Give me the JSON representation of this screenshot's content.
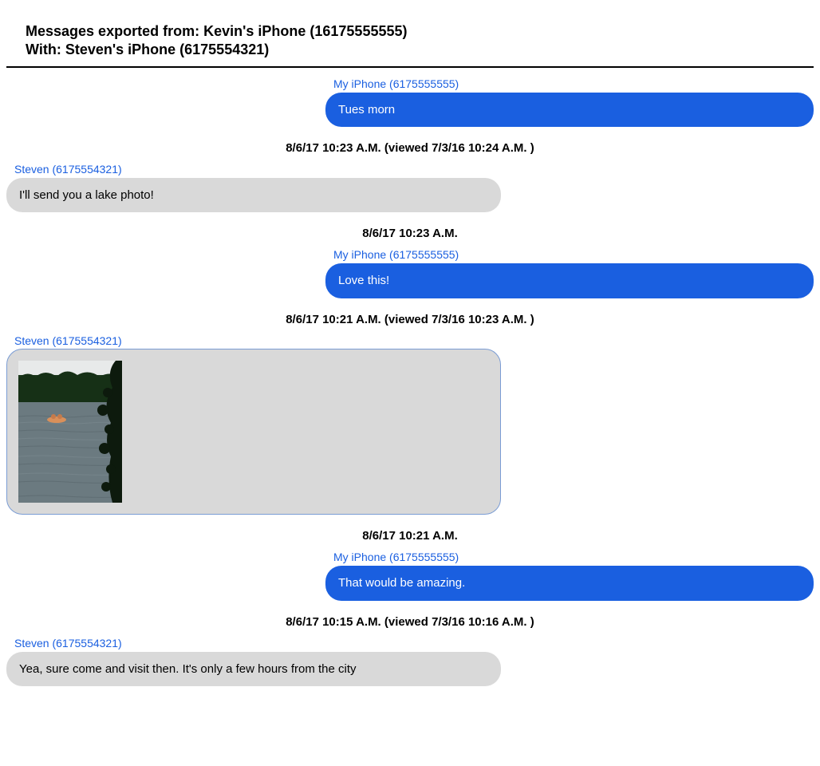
{
  "header": {
    "line1": "Messages exported from: Kevin's iPhone (16175555555)",
    "line2": "With: Steven's iPhone (6175554321)"
  },
  "senders": {
    "me": "My iPhone (6175555555)",
    "them": "Steven (6175554321)"
  },
  "messages": [
    {
      "side": "out",
      "sender_key": "me",
      "text": "Tues morn",
      "timestamp_after": "8/6/17 10:23 A.M. (viewed 7/3/16 10:24 A.M. )"
    },
    {
      "side": "in",
      "sender_key": "them",
      "text": "I'll send you a lake photo!",
      "timestamp_after": "8/6/17 10:23 A.M."
    },
    {
      "side": "out",
      "sender_key": "me",
      "text": "Love this!",
      "timestamp_after": "8/6/17 10:21 A.M. (viewed 7/3/16 10:23 A.M. )"
    },
    {
      "side": "in",
      "sender_key": "them",
      "is_image": true,
      "image_desc": "lake-photo",
      "timestamp_after": "8/6/17 10:21 A.M."
    },
    {
      "side": "out",
      "sender_key": "me",
      "text": "That would be amazing.",
      "timestamp_after": "8/6/17 10:15 A.M. (viewed 7/3/16 10:16 A.M. )"
    },
    {
      "side": "in",
      "sender_key": "them",
      "text": "Yea, sure come and visit then. It's only a few hours from the city"
    }
  ]
}
